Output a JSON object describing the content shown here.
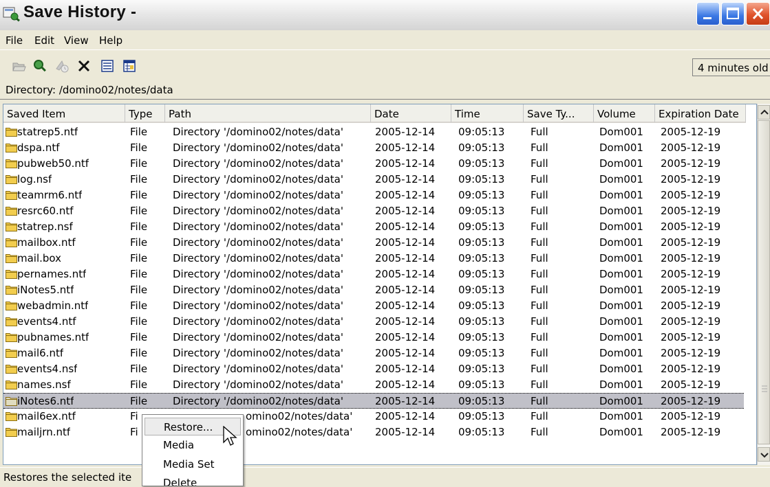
{
  "window": {
    "title": "Save History -",
    "buttons": [
      "minimize",
      "maximize",
      "close"
    ]
  },
  "menubar": {
    "items": [
      "File",
      "Edit",
      "View",
      "Help"
    ]
  },
  "toolbar": {
    "icons": [
      "open-folder-icon",
      "search-restore-icon",
      "history-icon",
      "delete-x-icon",
      "list-view-icon",
      "details-view-icon"
    ],
    "age_label": "4 minutes old"
  },
  "directory": {
    "label": "Directory: /domino02/notes/data"
  },
  "table": {
    "columns": [
      "Saved Item",
      "Type",
      "Path",
      "Date",
      "Time",
      "Save Ty...",
      "Volume",
      "Expiration Date"
    ],
    "rows": [
      {
        "name": "statrep5.ntf",
        "type": "File",
        "path": "Directory '/domino02/notes/data'",
        "date": "2005-12-14",
        "time": "09:05:13",
        "save_type": "Full",
        "volume": "Dom001",
        "expiration": "2005-12-19"
      },
      {
        "name": "dspa.ntf",
        "type": "File",
        "path": "Directory '/domino02/notes/data'",
        "date": "2005-12-14",
        "time": "09:05:13",
        "save_type": "Full",
        "volume": "Dom001",
        "expiration": "2005-12-19"
      },
      {
        "name": "pubweb50.ntf",
        "type": "File",
        "path": "Directory '/domino02/notes/data'",
        "date": "2005-12-14",
        "time": "09:05:13",
        "save_type": "Full",
        "volume": "Dom001",
        "expiration": "2005-12-19"
      },
      {
        "name": "log.nsf",
        "type": "File",
        "path": "Directory '/domino02/notes/data'",
        "date": "2005-12-14",
        "time": "09:05:13",
        "save_type": "Full",
        "volume": "Dom001",
        "expiration": "2005-12-19"
      },
      {
        "name": "teamrm6.ntf",
        "type": "File",
        "path": "Directory '/domino02/notes/data'",
        "date": "2005-12-14",
        "time": "09:05:13",
        "save_type": "Full",
        "volume": "Dom001",
        "expiration": "2005-12-19"
      },
      {
        "name": "resrc60.ntf",
        "type": "File",
        "path": "Directory '/domino02/notes/data'",
        "date": "2005-12-14",
        "time": "09:05:13",
        "save_type": "Full",
        "volume": "Dom001",
        "expiration": "2005-12-19"
      },
      {
        "name": "statrep.nsf",
        "type": "File",
        "path": "Directory '/domino02/notes/data'",
        "date": "2005-12-14",
        "time": "09:05:13",
        "save_type": "Full",
        "volume": "Dom001",
        "expiration": "2005-12-19"
      },
      {
        "name": "mailbox.ntf",
        "type": "File",
        "path": "Directory '/domino02/notes/data'",
        "date": "2005-12-14",
        "time": "09:05:13",
        "save_type": "Full",
        "volume": "Dom001",
        "expiration": "2005-12-19"
      },
      {
        "name": "mail.box",
        "type": "File",
        "path": "Directory '/domino02/notes/data'",
        "date": "2005-12-14",
        "time": "09:05:13",
        "save_type": "Full",
        "volume": "Dom001",
        "expiration": "2005-12-19"
      },
      {
        "name": "pernames.ntf",
        "type": "File",
        "path": "Directory '/domino02/notes/data'",
        "date": "2005-12-14",
        "time": "09:05:13",
        "save_type": "Full",
        "volume": "Dom001",
        "expiration": "2005-12-19"
      },
      {
        "name": "iNotes5.ntf",
        "type": "File",
        "path": "Directory '/domino02/notes/data'",
        "date": "2005-12-14",
        "time": "09:05:13",
        "save_type": "Full",
        "volume": "Dom001",
        "expiration": "2005-12-19"
      },
      {
        "name": "webadmin.ntf",
        "type": "File",
        "path": "Directory '/domino02/notes/data'",
        "date": "2005-12-14",
        "time": "09:05:13",
        "save_type": "Full",
        "volume": "Dom001",
        "expiration": "2005-12-19"
      },
      {
        "name": "events4.ntf",
        "type": "File",
        "path": "Directory '/domino02/notes/data'",
        "date": "2005-12-14",
        "time": "09:05:13",
        "save_type": "Full",
        "volume": "Dom001",
        "expiration": "2005-12-19"
      },
      {
        "name": "pubnames.ntf",
        "type": "File",
        "path": "Directory '/domino02/notes/data'",
        "date": "2005-12-14",
        "time": "09:05:13",
        "save_type": "Full",
        "volume": "Dom001",
        "expiration": "2005-12-19"
      },
      {
        "name": "mail6.ntf",
        "type": "File",
        "path": "Directory '/domino02/notes/data'",
        "date": "2005-12-14",
        "time": "09:05:13",
        "save_type": "Full",
        "volume": "Dom001",
        "expiration": "2005-12-19"
      },
      {
        "name": "events4.nsf",
        "type": "File",
        "path": "Directory '/domino02/notes/data'",
        "date": "2005-12-14",
        "time": "09:05:13",
        "save_type": "Full",
        "volume": "Dom001",
        "expiration": "2005-12-19"
      },
      {
        "name": "names.nsf",
        "type": "File",
        "path": "Directory '/domino02/notes/data'",
        "date": "2005-12-14",
        "time": "09:05:13",
        "save_type": "Full",
        "volume": "Dom001",
        "expiration": "2005-12-19"
      },
      {
        "name": "iNotes6.ntf",
        "type": "File",
        "path": "Directory '/domino02/notes/data'",
        "date": "2005-12-14",
        "time": "09:05:13",
        "save_type": "Full",
        "volume": "Dom001",
        "expiration": "2005-12-19",
        "selected": true
      },
      {
        "name": "mail6ex.ntf",
        "type": "Fi",
        "path": "omino02/notes/data'",
        "date": "2005-12-14",
        "time": "09:05:13",
        "save_type": "Full",
        "volume": "Dom001",
        "expiration": "2005-12-19"
      },
      {
        "name": "mailjrn.ntf",
        "type": "Fi",
        "path": "omino02/notes/data'",
        "date": "2005-12-14",
        "time": "09:05:13",
        "save_type": "Full",
        "volume": "Dom001",
        "expiration": "2005-12-19"
      }
    ]
  },
  "context_menu": {
    "items": [
      "Restore...",
      "Media",
      "Media Set",
      "Delete"
    ],
    "highlighted": "Restore..."
  },
  "statusbar": {
    "text": "Restores the selected ite"
  },
  "colors": {
    "window_bg": "#ece9d8",
    "selection": "#c0c0c8",
    "folder": "#f2cd4e"
  }
}
